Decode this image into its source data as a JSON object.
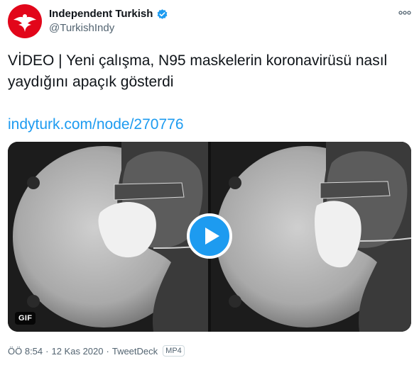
{
  "author": {
    "name": "Independent Turkish",
    "handle": "@TurkishIndy",
    "verified": true,
    "avatar_icon": "eagle-logo-icon",
    "avatar_color": "#e2061a"
  },
  "tweet": {
    "text": "VİDEO | Yeni çalışma, N95 maskelerin koronavirüsü nasıl yaydığını apaçık gösterdi",
    "link": "indyturk.com/node/270776"
  },
  "media": {
    "badge": "GIF",
    "play_icon": "play-icon"
  },
  "meta": {
    "time": "ÖÖ 8:54",
    "date": "12 Kas 2020",
    "source": "TweetDeck",
    "format": "MP4"
  },
  "colors": {
    "link": "#1d9bf0",
    "play_button": "#1d9bf0",
    "verified": "#1d9bf0",
    "secondary_text": "#536471"
  }
}
